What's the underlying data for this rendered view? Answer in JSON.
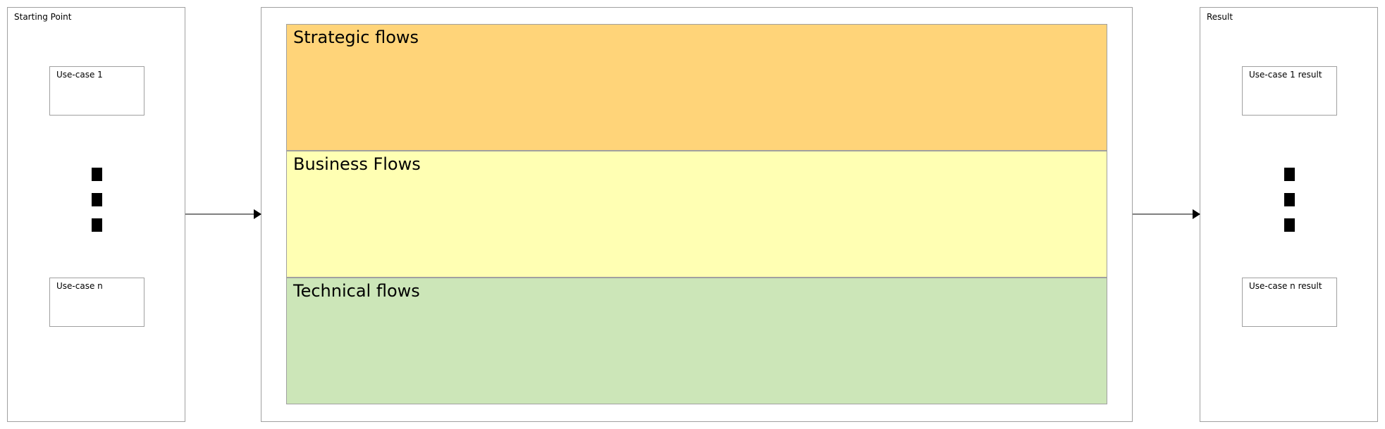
{
  "starting_point": {
    "title": "Starting Point",
    "use_cases": [
      {
        "label": "Use-case 1"
      },
      {
        "label": "Use-case n"
      }
    ]
  },
  "flows": {
    "lanes": [
      {
        "label": "Strategic flows",
        "color": "#FFD479"
      },
      {
        "label": "Business Flows",
        "color": "#FFFFB3"
      },
      {
        "label": "Technical flows",
        "color": "#CCE6B8"
      }
    ]
  },
  "result": {
    "title": "Result",
    "use_cases": [
      {
        "label": "Use-case 1 result"
      },
      {
        "label": "Use-case n result"
      }
    ]
  },
  "colors": {
    "border": "#a0a0a0",
    "ellipsis_dots": "#000000",
    "arrow": "#000000"
  }
}
